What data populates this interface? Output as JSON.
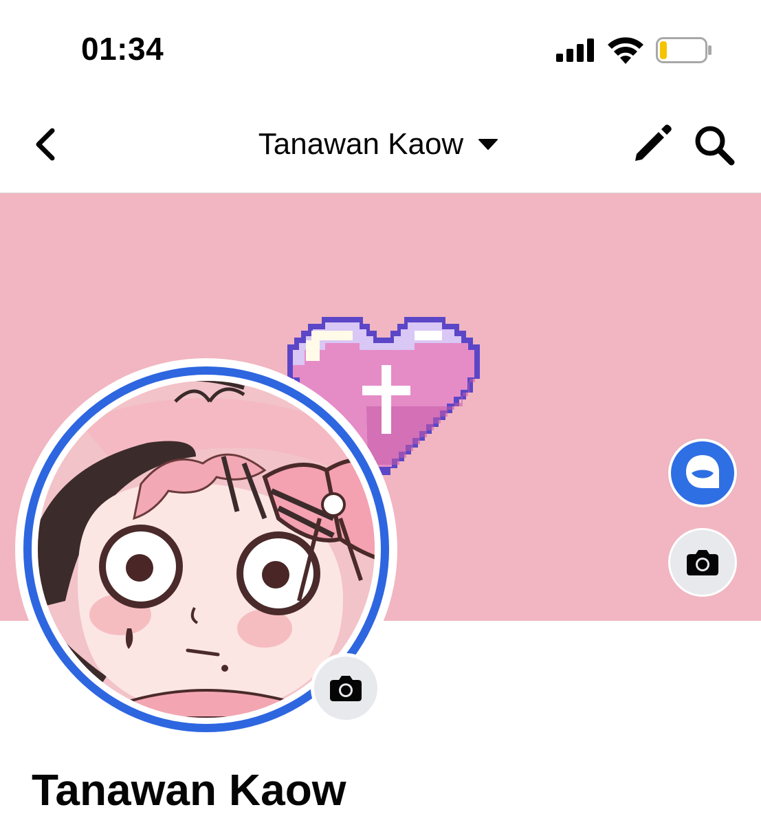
{
  "status_bar": {
    "time": "01:34",
    "signal_icon": "cellular-signal-icon",
    "wifi_icon": "wifi-icon",
    "battery_icon": "battery-low-icon",
    "battery_level": 0.15,
    "battery_color": "#f5c400"
  },
  "nav": {
    "back_icon": "chevron-left-icon",
    "title": "Tanawan Kaow",
    "title_caret_icon": "caret-down-icon",
    "edit_icon": "pencil-icon",
    "search_icon": "search-icon"
  },
  "cover": {
    "background_color": "#f1b6c1",
    "art_icon": "pixel-heart-cross-icon",
    "avatar_button_icon": "avatar-icon",
    "avatar_button_color": "#2f6fe4",
    "camera_button_icon": "camera-icon"
  },
  "profile": {
    "name": "Tanawan Kaow",
    "story_ring_color": "#2e66e0",
    "photo_icon": "anime-character-avatar",
    "camera_button_icon": "camera-icon"
  }
}
